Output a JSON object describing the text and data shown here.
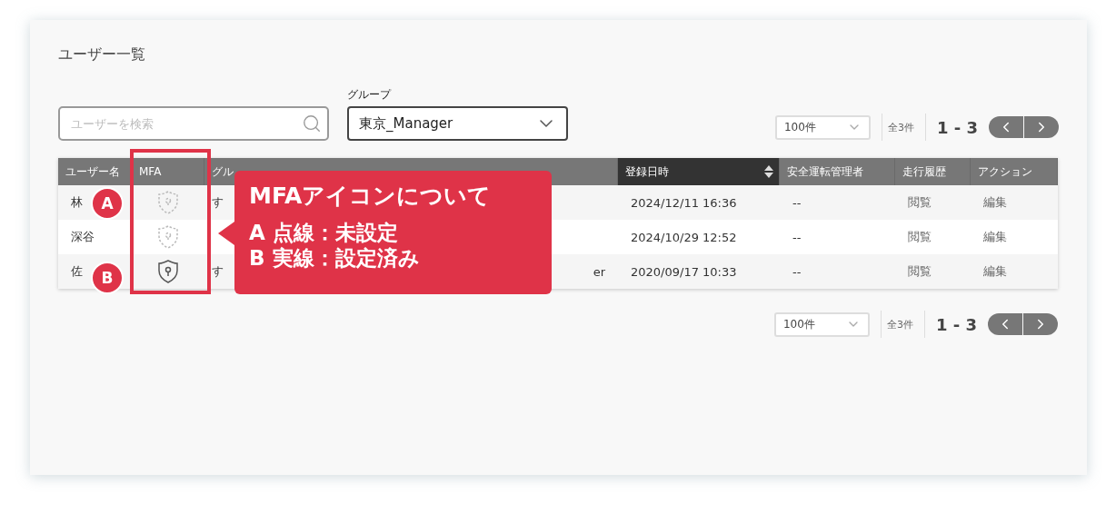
{
  "title": "ユーザー一覧",
  "search": {
    "placeholder": "ユーザーを検索"
  },
  "group_filter": {
    "label": "グループ",
    "value": "東京_Manager"
  },
  "pagination_top": {
    "per_page": "100件",
    "total": "全3件",
    "range": "1 - 3"
  },
  "table": {
    "columns": [
      {
        "label": "ユーザー名",
        "sorted": false
      },
      {
        "label": "MFA",
        "sorted": false
      },
      {
        "label": "グル",
        "sorted": false
      },
      {
        "label": "登録日時",
        "sorted": true
      },
      {
        "label": "安全運転管理者",
        "sorted": false
      },
      {
        "label": "走行履歴",
        "sorted": false
      },
      {
        "label": "アクション",
        "sorted": false
      }
    ],
    "rows": [
      {
        "name": "林",
        "mfa_set": false,
        "group": "す",
        "registered": "2024/12/11 16:36",
        "manager": "--",
        "history": "閲覧",
        "action": "編集"
      },
      {
        "name": "深谷",
        "mfa_set": false,
        "registered": "2024/10/29 12:52",
        "manager": "--",
        "history": "閲覧",
        "action": "編集"
      },
      {
        "name": "佐",
        "mfa_set": true,
        "group": "す",
        "group_tail": "er",
        "registered": "2020/09/17 10:33",
        "manager": "--",
        "history": "閲覧",
        "action": "編集"
      }
    ]
  },
  "pagination_bottom": {
    "per_page": "100件",
    "total": "全3件",
    "range": "1 - 3"
  },
  "annotation": {
    "badges": [
      "A",
      "B"
    ],
    "callout_title": "MFAアイコンについて",
    "callout_lines": [
      "A 点線：未設定",
      "B 実線：設定済み"
    ]
  }
}
